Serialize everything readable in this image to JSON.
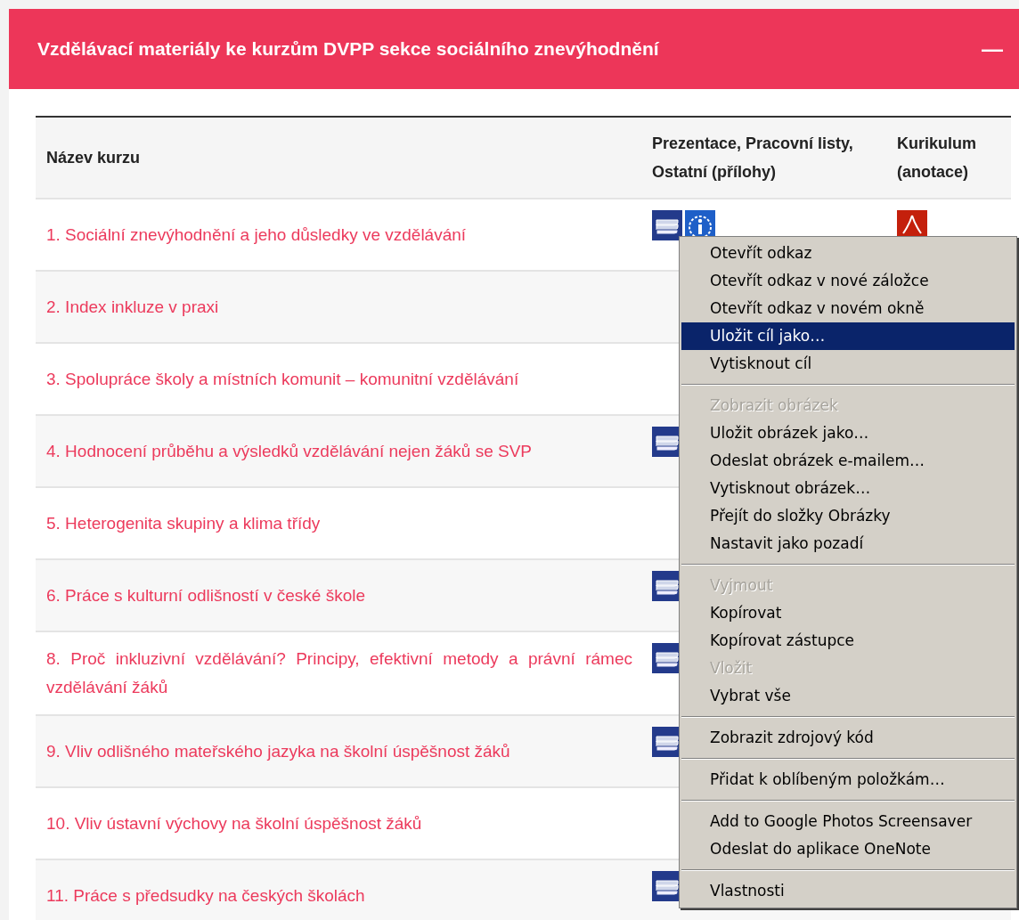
{
  "panel": {
    "title": "Vzdělávací materiály ke kurzům DVPP sekce sociálního znevýhodnění",
    "collapse": "—"
  },
  "table": {
    "columns": [
      "Název kurzu",
      "Prezentace, Pracovní listy, Ostatní (přílohy)",
      "Kurikulum (anotace)"
    ],
    "rows": [
      {
        "title": "1. Sociální znevýhodnění a jeho důsledky ve vzdělávání",
        "materials": [
          {
            "kind": "stack"
          },
          {
            "kind": "info"
          }
        ],
        "curriculum": true
      },
      {
        "title": "2. Index inkluze v praxi",
        "materials": [],
        "curriculum": false
      },
      {
        "title": "3. Spolupráce školy a místních komunit – komunitní vzdělávání",
        "materials": [],
        "curriculum": false
      },
      {
        "title": "4. Hodnocení průběhu a výsledků vzdělávání nejen žáků se SVP",
        "materials": [
          {
            "kind": "stack"
          }
        ],
        "curriculum": false
      },
      {
        "title": "5. Heterogenita skupiny a klima třídy",
        "materials": [],
        "curriculum": false
      },
      {
        "title": "6. Práce s kulturní odlišností v české škole",
        "materials": [
          {
            "kind": "stack"
          }
        ],
        "curriculum": false
      },
      {
        "title": "8. Proč inkluzivní vzdělávání? Principy, efektivní metody a právní rámec vzdělávání žáků",
        "materials": [
          {
            "kind": "stack"
          }
        ],
        "curriculum": false
      },
      {
        "title": "9. Vliv odlišného mateřského jazyka na školní úspěšnost žáků",
        "materials": [
          {
            "kind": "stack"
          }
        ],
        "curriculum": false
      },
      {
        "title": "10. Vliv ústavní výchovy na školní úspěšnost žáků",
        "materials": [],
        "curriculum": false
      },
      {
        "title": "11. Práce s předsudky na českých školách",
        "materials": [
          {
            "kind": "stack"
          }
        ],
        "curriculum": false
      }
    ]
  },
  "context_menu": [
    {
      "kind": "item",
      "label": "Otevřít odkaz",
      "disabled": false,
      "selected": false
    },
    {
      "kind": "item",
      "label": "Otevřít odkaz v nové záložce",
      "disabled": false,
      "selected": false
    },
    {
      "kind": "item",
      "label": "Otevřít odkaz v novém okně",
      "disabled": false,
      "selected": false
    },
    {
      "kind": "item",
      "label": "Uložit cíl jako…",
      "disabled": false,
      "selected": true
    },
    {
      "kind": "item",
      "label": "Vytisknout cíl",
      "disabled": false,
      "selected": false
    },
    {
      "kind": "separator"
    },
    {
      "kind": "item",
      "label": "Zobrazit obrázek",
      "disabled": true,
      "selected": false
    },
    {
      "kind": "item",
      "label": "Uložit obrázek jako…",
      "disabled": false,
      "selected": false
    },
    {
      "kind": "item",
      "label": "Odeslat obrázek e-mailem…",
      "disabled": false,
      "selected": false
    },
    {
      "kind": "item",
      "label": "Vytisknout obrázek…",
      "disabled": false,
      "selected": false
    },
    {
      "kind": "item",
      "label": "Přejít do složky Obrázky",
      "disabled": false,
      "selected": false
    },
    {
      "kind": "item",
      "label": "Nastavit jako pozadí",
      "disabled": false,
      "selected": false
    },
    {
      "kind": "separator"
    },
    {
      "kind": "item",
      "label": "Vyjmout",
      "disabled": true,
      "selected": false
    },
    {
      "kind": "item",
      "label": "Kopírovat",
      "disabled": false,
      "selected": false
    },
    {
      "kind": "item",
      "label": "Kopírovat zástupce",
      "disabled": false,
      "selected": false
    },
    {
      "kind": "item",
      "label": "Vložit",
      "disabled": true,
      "selected": false
    },
    {
      "kind": "item",
      "label": "Vybrat vše",
      "disabled": false,
      "selected": false
    },
    {
      "kind": "separator"
    },
    {
      "kind": "item",
      "label": "Zobrazit zdrojový kód",
      "disabled": false,
      "selected": false
    },
    {
      "kind": "separator"
    },
    {
      "kind": "item",
      "label": "Přidat k oblíbeným položkám…",
      "disabled": false,
      "selected": false
    },
    {
      "kind": "separator"
    },
    {
      "kind": "item",
      "label": "Add to Google Photos Screensaver",
      "disabled": false,
      "selected": false
    },
    {
      "kind": "item",
      "label": "Odeslat do aplikace OneNote",
      "disabled": false,
      "selected": false
    },
    {
      "kind": "separator"
    },
    {
      "kind": "item",
      "label": "Vlastnosti",
      "disabled": false,
      "selected": false
    }
  ]
}
